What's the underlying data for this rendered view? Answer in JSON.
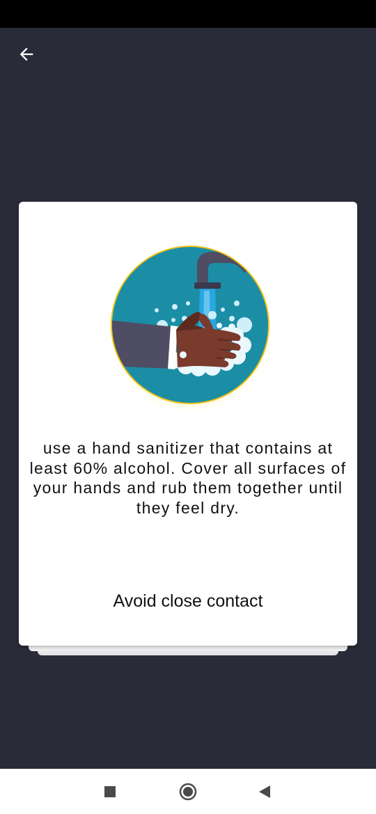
{
  "app_bar": {
    "back_icon": "arrow-left-icon"
  },
  "card": {
    "description": "use a hand sanitizer that contains at least 60% alcohol. Cover all surfaces of your hands and rub them together until they feel dry.",
    "title": "Avoid close contact",
    "illustration_icon": "handwashing-illustration"
  },
  "nav_bar": {
    "recents_icon": "square-recents-icon",
    "home_icon": "circle-home-icon",
    "back_icon": "triangle-back-icon"
  },
  "colors": {
    "background": "#2a2b38",
    "card": "#ffffff",
    "circle_bg": "#1b8ea6",
    "circle_ring": "#f3c316",
    "water": "#2aa8e6",
    "skin": "#7a3a2c",
    "sleeve": "#4e4d63"
  }
}
